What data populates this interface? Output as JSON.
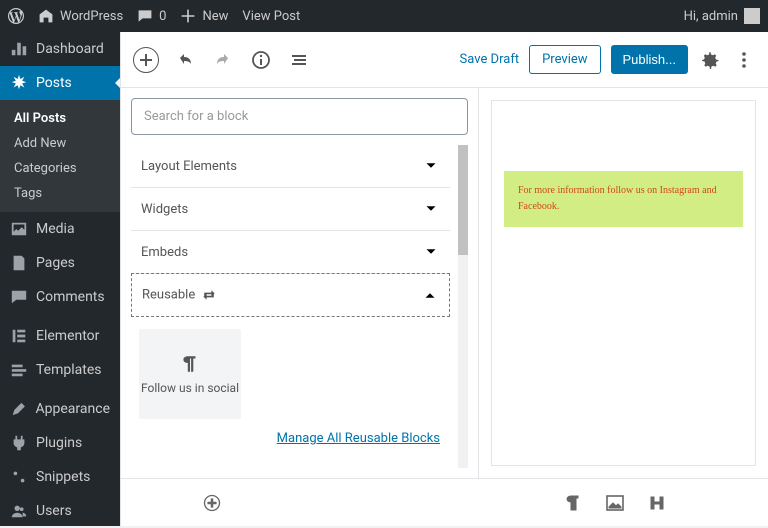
{
  "adminbar": {
    "site": "WordPress",
    "comments": "0",
    "new": "New",
    "view": "View Post",
    "greeting": "Hi, admin"
  },
  "sidebar": {
    "dashboard": "Dashboard",
    "posts": "Posts",
    "posts_sub": {
      "all": "All Posts",
      "add": "Add New",
      "cat": "Categories",
      "tags": "Tags"
    },
    "media": "Media",
    "pages": "Pages",
    "comments": "Comments",
    "elementor": "Elementor",
    "templates": "Templates",
    "appearance": "Appearance",
    "plugins": "Plugins",
    "snippets": "Snippets",
    "users": "Users"
  },
  "toolbar": {
    "save_draft": "Save Draft",
    "preview": "Preview",
    "publish": "Publish..."
  },
  "inserter": {
    "search_placeholder": "Search for a block",
    "cat_layout": "Layout Elements",
    "cat_widgets": "Widgets",
    "cat_embeds": "Embeds",
    "cat_reusable": "Reusable",
    "block_follow": "Follow us in social",
    "manage": "Manage All Reusable Blocks"
  },
  "preview": {
    "note": "For more information follow us on Instagram and Facebook."
  }
}
